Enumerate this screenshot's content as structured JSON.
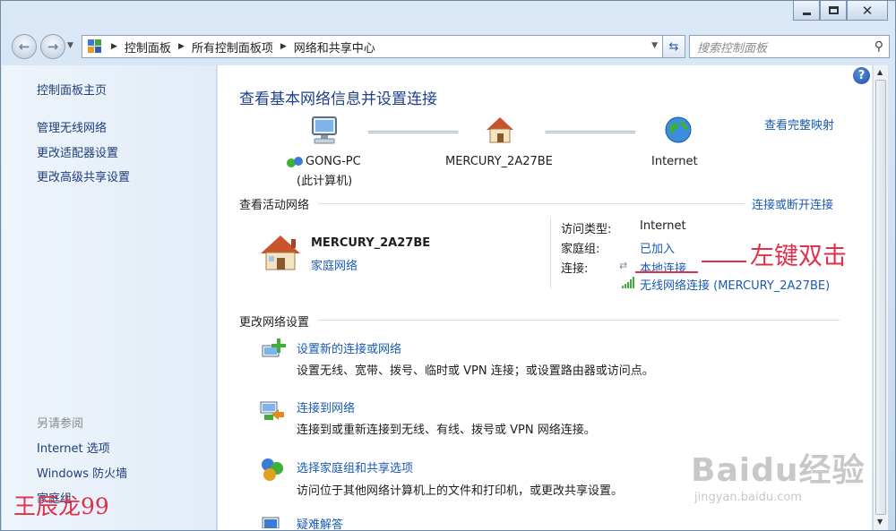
{
  "nav": {
    "breadcrumb": [
      "控制面板",
      "所有控制面板项",
      "网络和共享中心"
    ],
    "search_placeholder": "搜索控制面板"
  },
  "sidebar": {
    "home": "控制面板主页",
    "links": [
      "管理无线网络",
      "更改适配器设置",
      "更改高级共享设置"
    ],
    "see_also_heading": "另请参阅",
    "see_also": [
      "Internet 选项",
      "Windows 防火墙",
      "家庭组"
    ]
  },
  "main": {
    "title": "查看基本网络信息并设置连接",
    "view_full_map": "查看完整映射",
    "map": {
      "computer": "GONG-PC",
      "computer_sub": "(此计算机)",
      "router": "MERCURY_2A27BE",
      "internet": "Internet"
    },
    "active_heading": "查看活动网络",
    "connect_disconnect": "连接或断开连接",
    "active_network": {
      "name": "MERCURY_2A27BE",
      "type": "家庭网络",
      "access_type_label": "访问类型:",
      "access_type_value": "Internet",
      "homegroup_label": "家庭组:",
      "homegroup_value": "已加入",
      "connections_label": "连接:",
      "connection_1": "本地连接",
      "connection_2": "无线网络连接 (MERCURY_2A27BE)"
    },
    "change_heading": "更改网络设置",
    "tasks": [
      {
        "title": "设置新的连接或网络",
        "desc": "设置无线、宽带、拨号、临时或 VPN 连接；或设置路由器或访问点。"
      },
      {
        "title": "连接到网络",
        "desc": "连接到或重新连接到无线、有线、拨号或 VPN 网络连接。"
      },
      {
        "title": "选择家庭组和共享选项",
        "desc": "访问位于其他网络计算机上的文件和打印机，或更改共享设置。"
      },
      {
        "title": "疑难解答",
        "desc": ""
      }
    ]
  },
  "annotation": {
    "text": "左键双击",
    "author": "王辰龙99"
  },
  "watermark": {
    "brand": "Baidu经验",
    "url": "jingyan.baidu.com"
  }
}
